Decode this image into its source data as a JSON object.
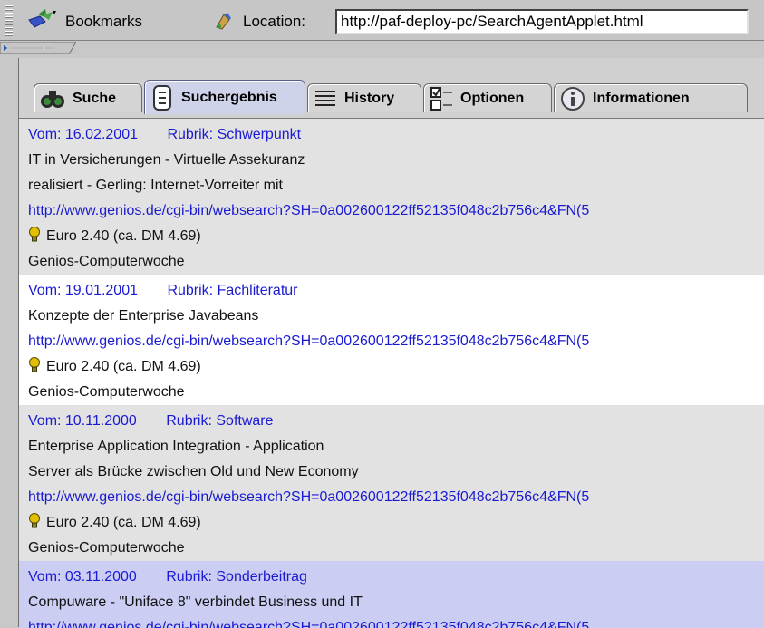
{
  "toolbar": {
    "bookmarks_label": "Bookmarks",
    "location_label": "Location:",
    "location_value": "http://paf-deploy-pc/SearchAgentApplet.html"
  },
  "tabs": [
    {
      "label": "Suche",
      "icon": "binoculars-icon",
      "active": false
    },
    {
      "label": "Suchergebnis",
      "icon": "result-list-icon",
      "active": true
    },
    {
      "label": "History",
      "icon": "history-lines-icon",
      "active": false
    },
    {
      "label": "Optionen",
      "icon": "checkbox-options-icon",
      "active": false
    },
    {
      "label": "Informationen",
      "icon": "info-icon",
      "active": false
    }
  ],
  "results": [
    {
      "date": "Vom: 16.02.2001",
      "rubrik": "Rubrik: Schwerpunkt",
      "title_lines": [
        "IT in Versicherungen - Virtuelle Assekuranz",
        "realisiert - Gerling: Internet-Vorreiter mit"
      ],
      "url": "http://www.genios.de/cgi-bin/websearch?SH=0a002600122ff52135f048c2b756c4&FN(5",
      "price": "Euro 2.40 (ca. DM 4.69)",
      "source": "Genios-Computerwoche"
    },
    {
      "date": "Vom: 19.01.2001",
      "rubrik": "Rubrik: Fachliteratur",
      "title_lines": [
        "Konzepte der Enterprise Javabeans"
      ],
      "url": "http://www.genios.de/cgi-bin/websearch?SH=0a002600122ff52135f048c2b756c4&FN(5",
      "price": "Euro 2.40 (ca. DM 4.69)",
      "source": "Genios-Computerwoche"
    },
    {
      "date": "Vom: 10.11.2000",
      "rubrik": "Rubrik: Software",
      "title_lines": [
        "Enterprise Application Integration - Application",
        "Server als Brücke zwischen Old und New Economy"
      ],
      "url": "http://www.genios.de/cgi-bin/websearch?SH=0a002600122ff52135f048c2b756c4&FN(5",
      "price": "Euro 2.40 (ca. DM 4.69)",
      "source": "Genios-Computerwoche"
    },
    {
      "date": "Vom: 03.11.2000",
      "rubrik": "Rubrik: Sonderbeitrag",
      "title_lines": [
        "Compuware - \"Uniface 8\" verbindet Business und IT"
      ],
      "url": "http://www.genios.de/cgi-bin/websearch?SH=0a002600122ff52135f048c2b756c4&FN(5",
      "price": "",
      "source": ""
    }
  ],
  "colors": {
    "link_blue": "#1a1ad2",
    "row_grey": "#e2e2e2",
    "row_white": "#ffffff",
    "row_selected": "#cccdf3",
    "price_icon": "#d8b800"
  }
}
